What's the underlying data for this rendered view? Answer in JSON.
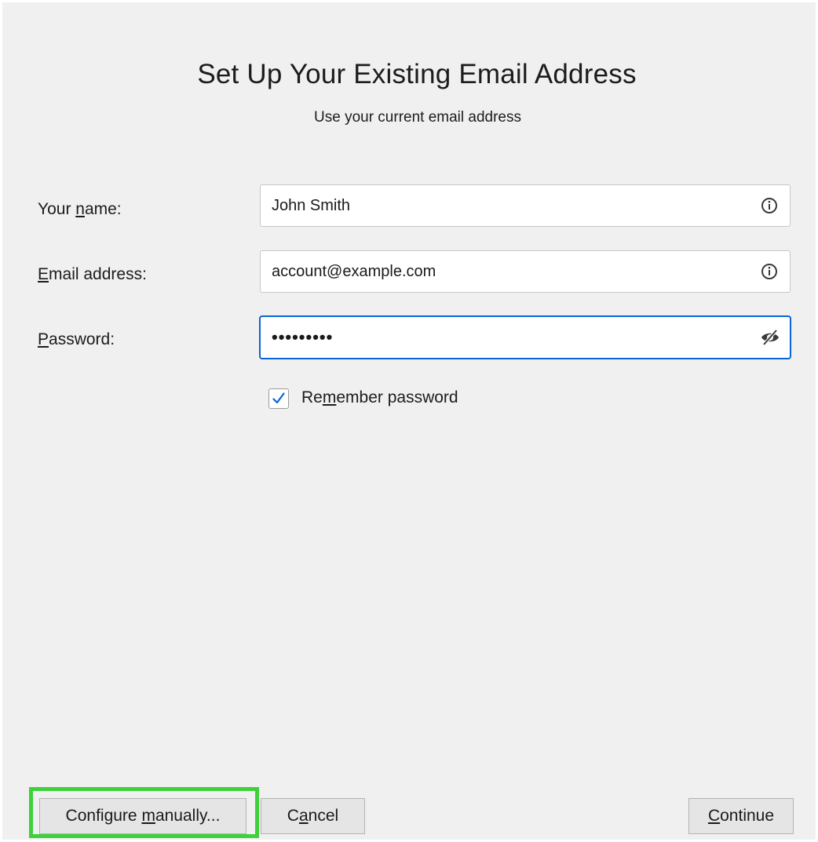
{
  "dialog": {
    "title": "Set Up Your Existing Email Address",
    "subtitle": "Use your current email address"
  },
  "form": {
    "name": {
      "label_pre": "Your ",
      "label_key": "n",
      "label_post": "ame:",
      "value": "John Smith",
      "icon": "info-icon"
    },
    "email": {
      "label_pre": "",
      "label_key": "E",
      "label_post": "mail address:",
      "value": "account@example.com",
      "icon": "info-icon"
    },
    "password": {
      "label_pre": "",
      "label_key": "P",
      "label_post": "assword:",
      "value": "•••••••••",
      "icon": "eye-slash-icon"
    },
    "remember": {
      "label_pre": "Re",
      "label_key": "m",
      "label_post": "ember password",
      "checked": true
    }
  },
  "buttons": {
    "configure": {
      "pre": "Configure ",
      "key": "m",
      "post": "anually..."
    },
    "cancel": {
      "pre": "C",
      "key": "a",
      "post": "ncel"
    },
    "continue": {
      "pre": "",
      "key": "C",
      "post": "ontinue"
    }
  },
  "colors": {
    "accent": "#0a64d6",
    "highlight": "#3fd13b",
    "background": "#f0f0f0"
  }
}
